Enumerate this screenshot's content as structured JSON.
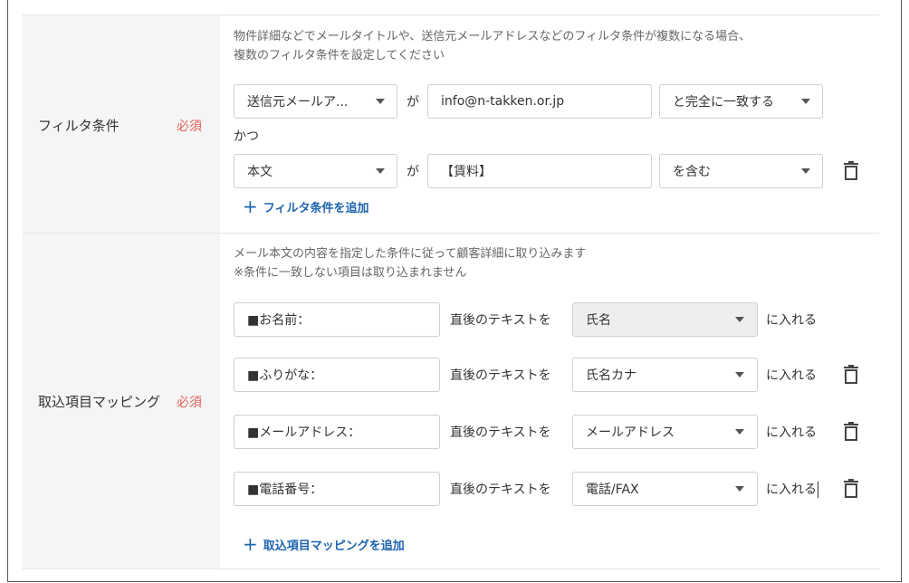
{
  "filter_section": {
    "label": "フィルタ条件",
    "required": "必須",
    "description_line1": "物件詳細などでメールタイトルや、送信元メールアドレスなどのフィルタ条件が複数になる場合、",
    "description_line2": "複数のフィルタ条件を設定してください",
    "conditions": [
      {
        "field": "送信元メールア...",
        "particle": "が",
        "value": "info@n-takken.or.jp",
        "operator": "と完全に一致する"
      },
      {
        "field": "本文",
        "particle": "が",
        "value": "【賃料】",
        "operator": "を含む"
      }
    ],
    "conjunction": "かつ",
    "add_label": "フィルタ条件を追加"
  },
  "mapping_section": {
    "label": "取込項目マッピング",
    "required": "必須",
    "description_line1": "メール本文の内容を指定した条件に従って顧客詳細に取り込みます",
    "description_line2": "※条件に一致しない項目は取り込まれません",
    "rows": [
      {
        "keyword": "■お名前：",
        "middle": "直後のテキストを",
        "target": "氏名",
        "suffix": "に入れる"
      },
      {
        "keyword": "■ふりがな：",
        "middle": "直後のテキストを",
        "target": "氏名カナ",
        "suffix": "に入れる"
      },
      {
        "keyword": "■メールアドレス：",
        "middle": "直後のテキストを",
        "target": "メールアドレス",
        "suffix": "に入れる"
      },
      {
        "keyword": "■電話番号：",
        "middle": "直後のテキストを",
        "target": "電話/FAX",
        "suffix": "に入れる"
      }
    ],
    "add_label": "取込項目マッピングを追加"
  },
  "icons": {
    "delete": "trash-icon",
    "dropdown": "chevron-down-icon",
    "add": "plus-icon"
  },
  "colors": {
    "required": "#e0605a",
    "link": "#1f64b0",
    "label_bg": "#f5f5f5",
    "disabled_bg": "#eeeeee"
  }
}
